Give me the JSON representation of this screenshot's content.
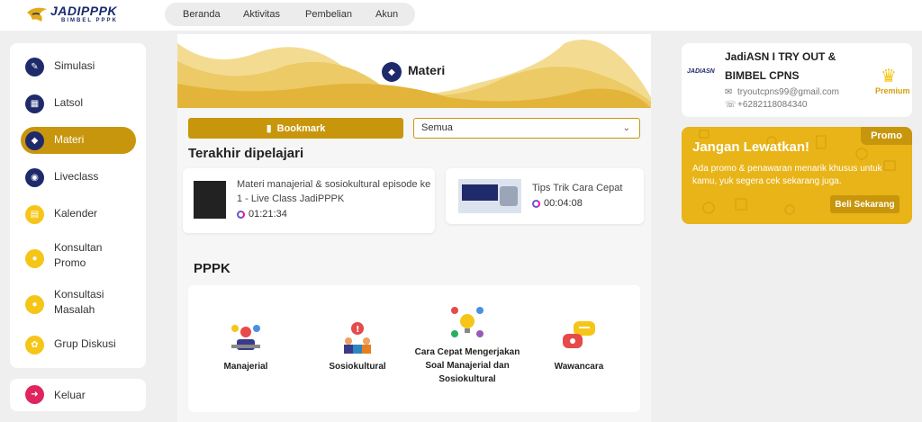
{
  "brand": {
    "title": "JADIPPPK",
    "subtitle": "BIMBEL PPPK"
  },
  "nav": [
    "Beranda",
    "Aktivitas",
    "Pembelian",
    "Akun"
  ],
  "sidebar": {
    "items": [
      {
        "label": "Simulasi",
        "icon": "document-edit-icon"
      },
      {
        "label": "Latsol",
        "icon": "calculator-icon"
      },
      {
        "label": "Materi",
        "icon": "book-icon",
        "active": true
      },
      {
        "label": "Liveclass",
        "icon": "broadcast-icon"
      },
      {
        "label": "Kalender",
        "icon": "calendar-icon"
      },
      {
        "label": "Konsultan",
        "label2": "Promo",
        "icon": "chat-icon"
      },
      {
        "label": "Konsultasi",
        "label2": "Masalah",
        "icon": "chat-question-icon"
      },
      {
        "label": "Grup Diskusi",
        "icon": "group-icon"
      }
    ],
    "logout": "Keluar"
  },
  "main": {
    "title": "Materi",
    "bookmark": "Bookmark",
    "filter": "Semua",
    "recent_title": "Terakhir dipelajari",
    "recent": [
      {
        "title_line1": "Materi manajerial & sosiokultural episode ke",
        "title_line2": "1 - Live Class JadiPPPK",
        "duration": "01:21:34"
      },
      {
        "title_line1": "Tips Trik Cara Cepat",
        "duration": "00:04:08"
      }
    ],
    "pppk_title": "PPPK",
    "categories": [
      {
        "line1": "Manajerial"
      },
      {
        "line1": "Sosiokultural"
      },
      {
        "line1": "Cara Cepat Mengerjakan",
        "line2": "Soal Manajerial dan",
        "line3": "Sosiokultural"
      },
      {
        "line1": "Wawancara"
      }
    ]
  },
  "profile": {
    "name_line1": "JadiASN I TRY OUT &",
    "name_line2": "BIMBEL CPNS",
    "email": "tryoutcpns99@gmail.com",
    "phone": "+6282118084340",
    "badge": "Premium",
    "logo_text": "JADIASN"
  },
  "promo": {
    "tag": "Promo",
    "title": "Jangan Lewatkan!",
    "text": "Ada promo & penawaran menarik khusus untuk kamu, yuk segera cek sekarang juga.",
    "button": "Beli Sekarang"
  },
  "colors": {
    "accent": "#c8960c",
    "navy": "#1f2a6b",
    "yellow": "#f5c518"
  }
}
